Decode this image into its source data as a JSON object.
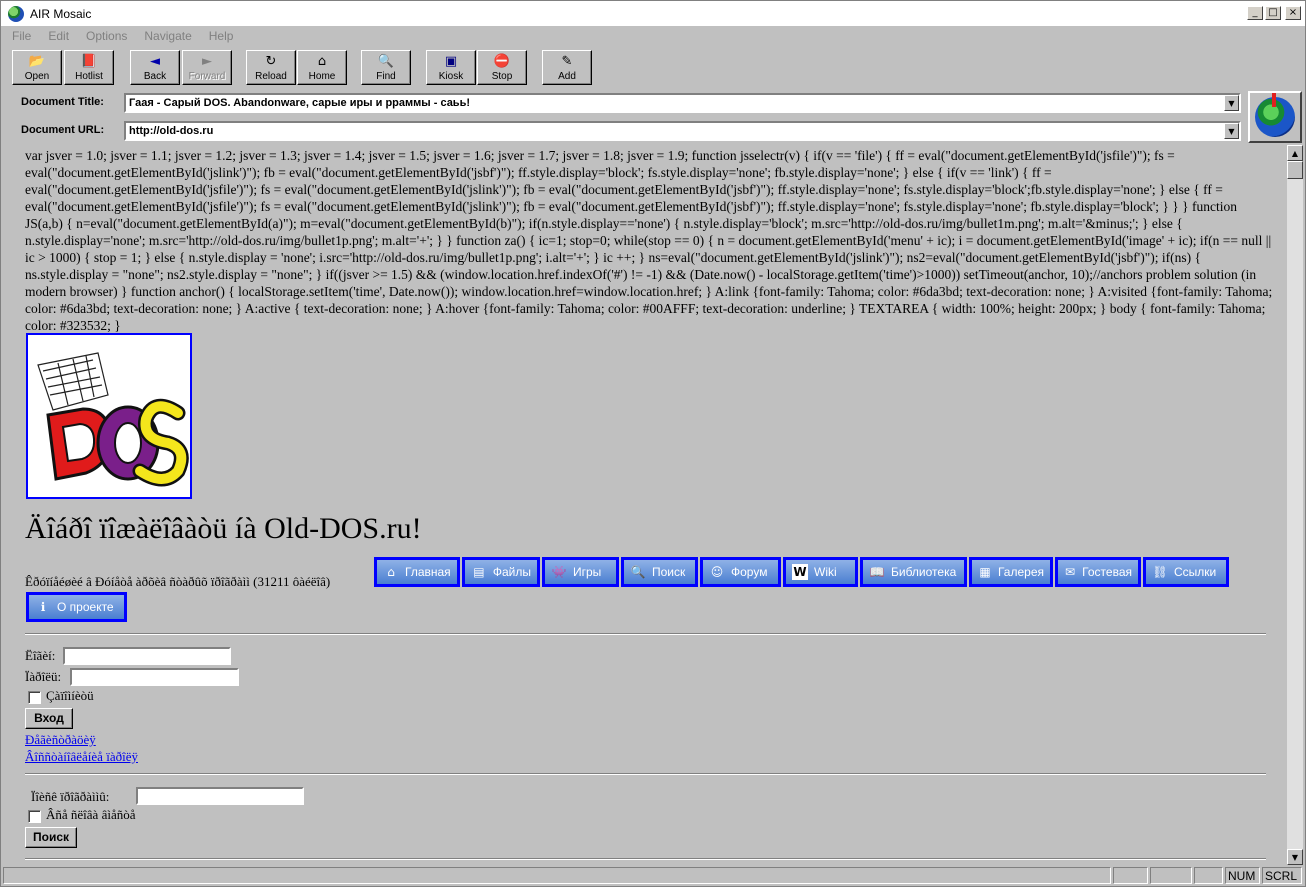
{
  "window": {
    "title": "AIR Mosaic",
    "controls": {
      "minimize": "_",
      "maximize": "□",
      "close": "×"
    }
  },
  "menu": [
    "File",
    "Edit",
    "Options",
    "Navigate",
    "Help"
  ],
  "toolbar": [
    {
      "label": "Open",
      "icon": "folder-open-icon",
      "glyph": "📂",
      "enabled": true
    },
    {
      "label": "Hotlist",
      "icon": "hotlist-icon",
      "glyph": "📕",
      "enabled": true
    },
    {
      "label": "Back",
      "icon": "back-arrow-icon",
      "glyph": "◄",
      "enabled": true
    },
    {
      "label": "Forward",
      "icon": "forward-arrow-icon",
      "glyph": "►",
      "enabled": false
    },
    {
      "label": "Reload",
      "icon": "reload-icon",
      "glyph": "↻",
      "enabled": true
    },
    {
      "label": "Home",
      "icon": "home-icon",
      "glyph": "⌂",
      "enabled": true
    },
    {
      "label": "Find",
      "icon": "find-magnifier-icon",
      "glyph": "🔍",
      "enabled": true
    },
    {
      "label": "Kiosk",
      "icon": "kiosk-icon",
      "glyph": "▣",
      "enabled": true
    },
    {
      "label": "Stop",
      "icon": "stop-sign-icon",
      "glyph": "⛔",
      "enabled": true
    },
    {
      "label": "Add",
      "icon": "add-hotlist-icon",
      "glyph": "✎",
      "enabled": true
    }
  ],
  "document": {
    "title_label": "Document Title:",
    "title_value": "Гаая - Сарый DOS. Abandonware, сарые иры и рраммы - саьь!",
    "url_label": "Document URL:",
    "url_value": "http://old-dos.ru"
  },
  "content": {
    "script_text": "var jsver = 1.0; jsver = 1.1; jsver = 1.2; jsver = 1.3; jsver = 1.4; jsver = 1.5; jsver = 1.6; jsver = 1.7; jsver = 1.8; jsver = 1.9; function jsselectr(v) { if(v == 'file') { ff = eval(\"document.getElementById('jsfile')\"); fs = eval(\"document.getElementById('jslink')\"); fb = eval(\"document.getElementById('jsbf')\"); ff.style.display='block'; fs.style.display='none'; fb.style.display='none'; } else { if(v == 'link') { ff = eval(\"document.getElementById('jsfile')\"); fs = eval(\"document.getElementById('jslink')\"); fb = eval(\"document.getElementById('jsbf')\"); ff.style.display='none'; fs.style.display='block';fb.style.display='none'; } else { ff = eval(\"document.getElementById('jsfile')\"); fs = eval(\"document.getElementById('jslink')\"); fb = eval(\"document.getElementById('jsbf')\"); ff.style.display='none'; fs.style.display='none'; fb.style.display='block'; } } } function JS(a,b) { n=eval(\"document.getElementById(a)\"); m=eval(\"document.getElementById(b)\"); if(n.style.display=='none') { n.style.display='block'; m.src='http://old-dos.ru/img/bullet1m.png'; m.alt='&minus;'; } else { n.style.display='none'; m.src='http://old-dos.ru/img/bullet1p.png'; m.alt='+'; } } function za() { ic=1; stop=0; while(stop == 0) { n = document.getElementById('menu' + ic); i = document.getElementById('image' + ic); if(n == null || ic > 1000) { stop = 1; } else { n.style.display = 'none'; i.src='http://old-dos.ru/img/bullet1p.png'; i.alt='+'; } ic ++; } ns=eval(\"document.getElementById('jslink')\"); ns2=eval(\"document.getElementById('jsbf')\"); if(ns) { ns.style.display = \"none\"; ns2.style.display = \"none\"; } if((jsver >= 1.5) && (window.location.href.indexOf('#') != -1) && (Date.now() - localStorage.getItem('time')>1000)) setTimeout(anchor, 10);//anchors problem solution (in modern browser) } function anchor() { localStorage.setItem('time', Date.now()); window.location.href=window.location.href; } A:link {font-family: Tahoma; color: #6da3bd; text-decoration: none; } A:visited {font-family: Tahoma; color: #6da3bd; text-decoration: none; } A:active { text-decoration: none; } A:hover {font-family: Tahoma; color: #00AFFF; text-decoration: underline; } TEXTAREA { width: 100%; height: 200px; } body { font-family: Tahoma; color: #323532; }",
    "logo_text": "DOS",
    "heading": "Äîáðî ïîæàëîâàòü íà Old-DOS.ru!",
    "online_text": "Êðóïíåéøèé â Ðóíåòå àðõèâ ñòàðûõ ïðîãðàìì (31211 ôàéëîâ)",
    "nav": [
      {
        "label": "Главная",
        "icon": "home-icon",
        "glyph": "⌂"
      },
      {
        "label": "Файлы",
        "icon": "files-terminal-icon",
        "glyph": "▤"
      },
      {
        "label": "Игры",
        "icon": "games-invader-icon",
        "glyph": "👾"
      },
      {
        "label": "Поиск",
        "icon": "search-icon",
        "glyph": "🔍"
      },
      {
        "label": "Форум",
        "icon": "forum-user-icon",
        "glyph": "☺"
      },
      {
        "label": "Wiki",
        "icon": "wiki-icon",
        "glyph": "W"
      },
      {
        "label": "Библиотека",
        "icon": "library-book-icon",
        "glyph": "📖"
      },
      {
        "label": "Галерея",
        "icon": "gallery-picture-icon",
        "glyph": "▦"
      },
      {
        "label": "Гостевая",
        "icon": "guestbook-icon",
        "glyph": "✉"
      },
      {
        "label": "Ссылки",
        "icon": "links-chain-icon",
        "glyph": "⛓"
      },
      {
        "label": "О проекте",
        "icon": "info-icon",
        "glyph": "ℹ"
      }
    ],
    "login": {
      "login_label": "Ëîãèí:",
      "password_label": "Ïàðîëü:",
      "remember_label": "Çàïîìíèòü",
      "submit": "Вход",
      "register_link": "Ðåãèñòðàöèÿ",
      "restore_link": "Âîññòàíîâëåíèå ïàðîëÿ"
    },
    "search": {
      "label": "Ïîèñê ïðîãðàììû:",
      "checkbox_label": "Âñå ñëîâà âìåñòå",
      "submit": "Поиск"
    }
  },
  "status": {
    "num": "NUM",
    "scrl": "SCRL"
  }
}
